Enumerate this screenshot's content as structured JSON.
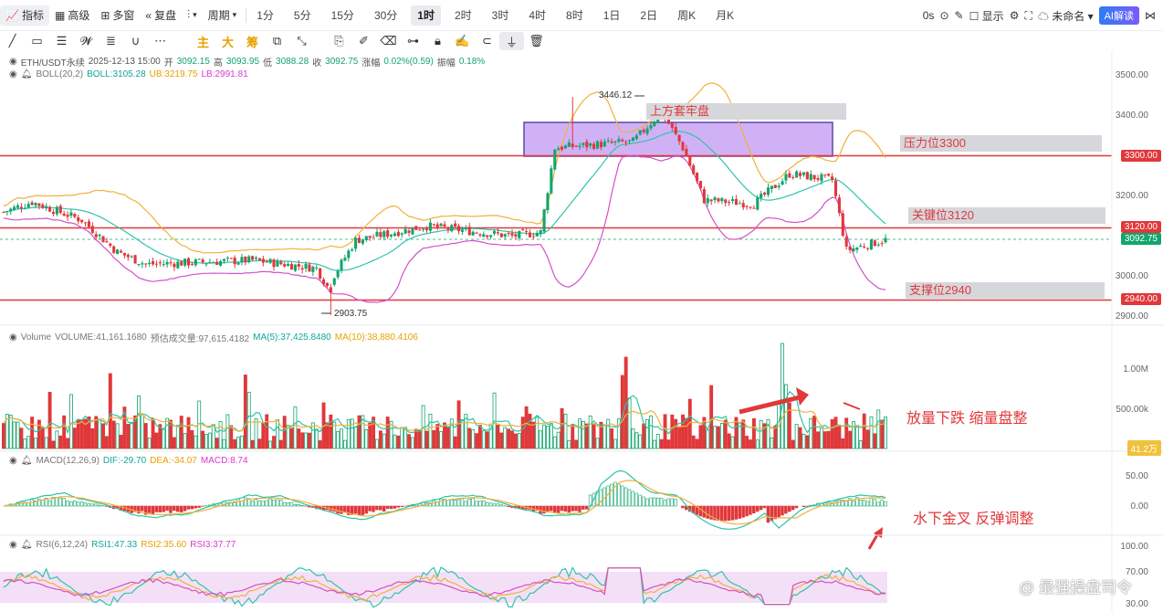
{
  "toolbar": {
    "indicator_label": "指标",
    "advanced_label": "高级",
    "multi_window_label": "多窗",
    "replay_label": "复盘",
    "period_label": "周期",
    "timeframes": [
      "1分",
      "5分",
      "15分",
      "30分",
      "1时",
      "2时",
      "3时",
      "4时",
      "8时",
      "1日",
      "2日",
      "周K",
      "月K"
    ],
    "active_timeframe": "1时",
    "zero_s": "0s",
    "display_label": "显示",
    "unnamed_label": "未命名",
    "ai_label": "AI解读"
  },
  "drawing_tools": {
    "text_tools": [
      "主",
      "大",
      "筹"
    ]
  },
  "legend": {
    "symbol": "ETH/USDT永续",
    "datetime": "2025-12-13 15:00",
    "open_label": "开",
    "open": "3092.15",
    "high_label": "高",
    "high": "3093.95",
    "low_label": "低",
    "low": "3088.28",
    "close_label": "收",
    "close": "3092.75",
    "change_label": "涨幅",
    "change": "0.02%(0.59)",
    "amp_label": "振幅",
    "amp": "0.18%",
    "boll_name": "BOLL(20,2)",
    "boll": "BOLL:3105.28",
    "ub": "UB:3219.75",
    "lb": "LB:2991.81"
  },
  "volume_legend": {
    "name": "Volume",
    "volume": "VOLUME:41,161.1680",
    "est": "预估成交量:97,615.4182",
    "ma5": "MA(5):37,425.8480",
    "ma10": "MA(10):38,880.4106"
  },
  "macd_legend": {
    "name": "MACD(12,26,9)",
    "dif": "DIF:-29.70",
    "dea": "DEA:-34.07",
    "macd": "MACD:8.74"
  },
  "rsi_legend": {
    "name": "RSI(6,12,24)",
    "rsi1": "RSI1:47.33",
    "rsi2": "RSI2:35.60",
    "rsi3": "RSI3:37.77"
  },
  "price_axis": [
    "3500.00",
    "3400.00",
    "3300.00",
    "3200.00",
    "3100.00",
    "3000.00",
    "2900.00"
  ],
  "price_tags": {
    "resistance": "3300.00",
    "key": "3120.00",
    "current": "3092.75",
    "support": "2940.00"
  },
  "volume_axis": [
    "1.00M",
    "500.00k"
  ],
  "volume_tag": "41.2万",
  "macd_axis": [
    "50.00",
    "0.00"
  ],
  "rsi_axis": [
    "100.00",
    "70.00",
    "30.00"
  ],
  "high_label": "3446.12",
  "low_label": "2903.75",
  "zones": {
    "top_box": "上方套牢盘",
    "resistance": "压力位3300",
    "key": "关键位3120",
    "support": "支撑位2940"
  },
  "annotations": {
    "volume": "放量下跌 缩量盘整",
    "macd": "水下金叉 反弹调整"
  },
  "watermark": "@ 最强操盘司令",
  "colors": {
    "up": "#12a56c",
    "down": "#e0383b",
    "boll_mid": "#2fc4a8",
    "boll_up": "#f2b03c",
    "boll_low": "#d64fc6",
    "rsi_band": "#f3e0f7",
    "box": "#c9a4f5"
  },
  "chart_data": {
    "type": "candlestick",
    "symbol": "ETH/USDT",
    "timeframe": "1h",
    "ylim": [
      2880,
      3530
    ],
    "levels": [
      3300,
      3120,
      2940
    ],
    "high": 3446.12,
    "low": 2903.75,
    "last_close": 3092.75
  }
}
